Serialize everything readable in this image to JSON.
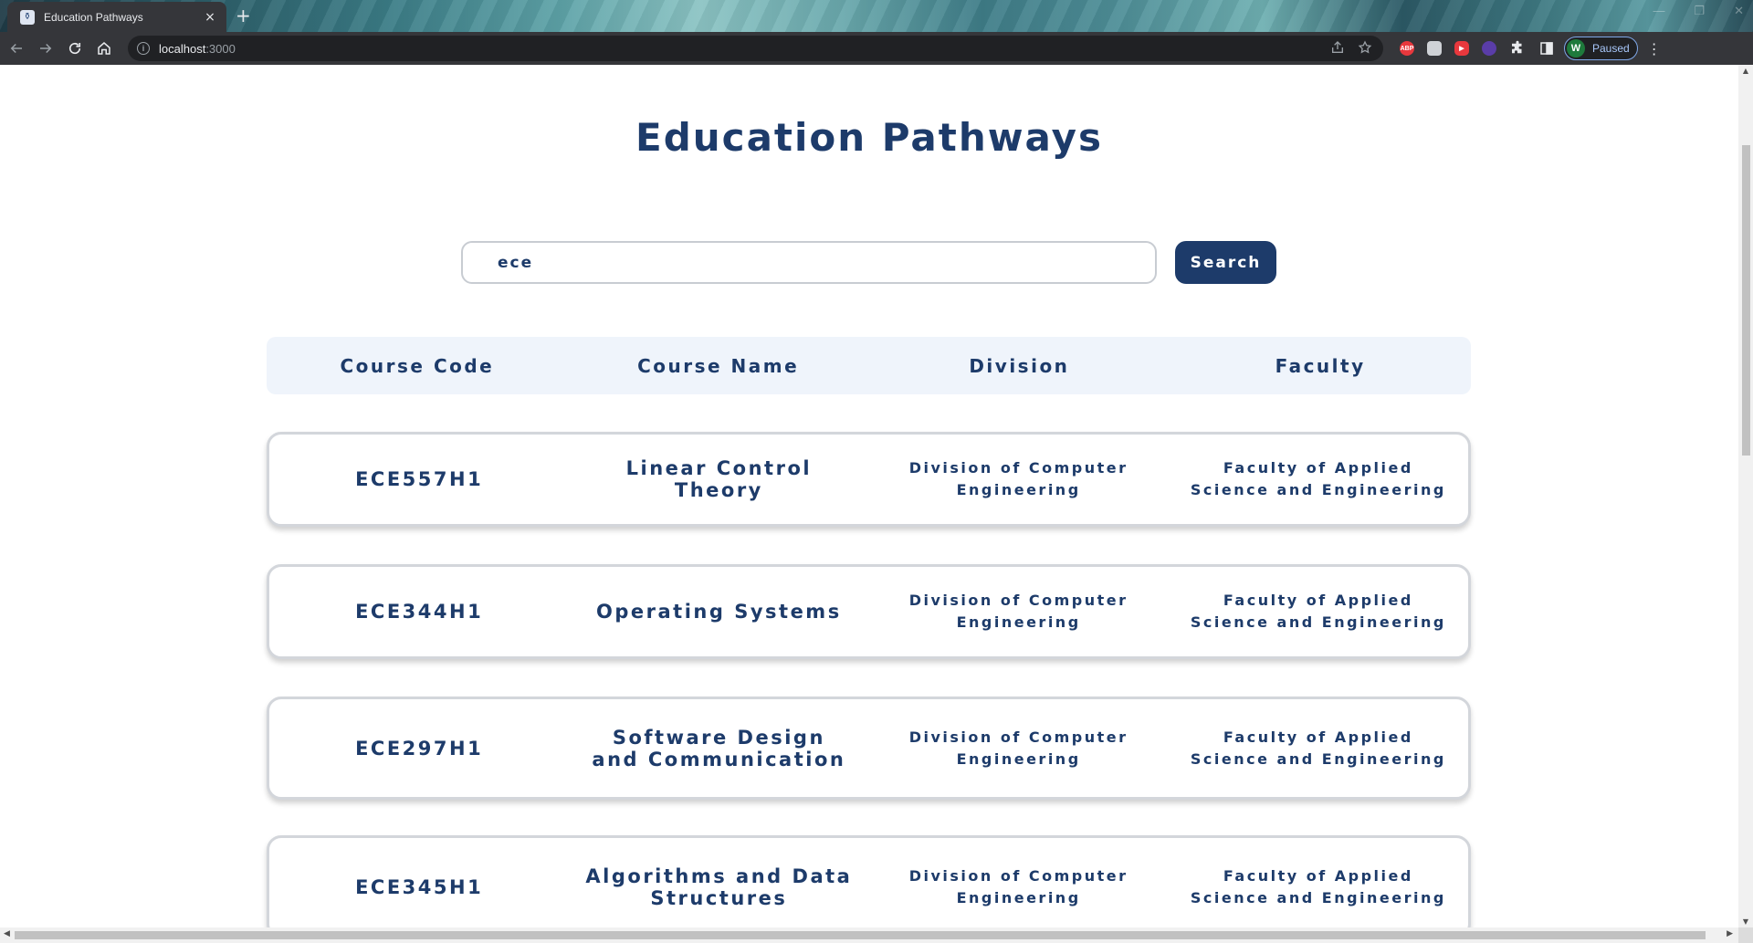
{
  "browser": {
    "tab_title": "Education Pathways",
    "tab_close": "×",
    "new_tab": "+",
    "url_host": "localhost",
    "url_port": ":3000",
    "info_glyph": "i",
    "ext_abp": "ABP",
    "ext_red": "▶",
    "profile_initial": "W",
    "profile_status": "Paused",
    "kebab": "⋮",
    "icons": [
      "back-icon",
      "forward-icon",
      "reload-icon",
      "home-icon",
      "share-icon",
      "star-icon",
      "puzzle-icon",
      "sidebar-icon"
    ]
  },
  "page": {
    "title": "Education Pathways",
    "search_value": "ece",
    "search_button": "Search"
  },
  "table": {
    "headers": [
      "Course Code",
      "Course Name",
      "Division",
      "Faculty"
    ],
    "rows": [
      {
        "code": "ECE557H1",
        "name": "Linear Control Theory",
        "division": "Division of Computer Engineering",
        "faculty": "Faculty of Applied Science and Engineering"
      },
      {
        "code": "ECE344H1",
        "name": "Operating Systems",
        "division": "Division of Computer Engineering",
        "faculty": "Faculty of Applied Science and Engineering"
      },
      {
        "code": "ECE297H1",
        "name": "Software Design and Communication",
        "division": "Division of Computer Engineering",
        "faculty": "Faculty of Applied Science and Engineering"
      },
      {
        "code": "ECE345H1",
        "name": "Algorithms and Data Structures",
        "division": "Division of Computer Engineering",
        "faculty": "Faculty of Applied Science and Engineering"
      }
    ]
  },
  "colors": {
    "brand_navy": "#1d3b6a",
    "header_bg": "#eff4fb",
    "card_border": "#d3d6db"
  }
}
